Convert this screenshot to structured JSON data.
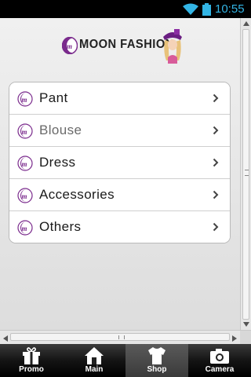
{
  "status_bar": {
    "time": "10:55"
  },
  "header": {
    "brand": "MOON FASHION"
  },
  "menu": {
    "items": [
      {
        "label": "Pant"
      },
      {
        "label": "Blouse"
      },
      {
        "label": "Dress"
      },
      {
        "label": "Accessories"
      },
      {
        "label": "Others"
      }
    ]
  },
  "tabbar": {
    "tabs": [
      {
        "label": "Promo",
        "icon": "gift-icon"
      },
      {
        "label": "Main",
        "icon": "home-icon"
      },
      {
        "label": "Shop",
        "icon": "tshirt-icon",
        "active": true
      },
      {
        "label": "Camera",
        "icon": "camera-icon"
      }
    ]
  },
  "colors": {
    "accent": "#33b5e5",
    "brand_purple": "#7a2a8c"
  }
}
